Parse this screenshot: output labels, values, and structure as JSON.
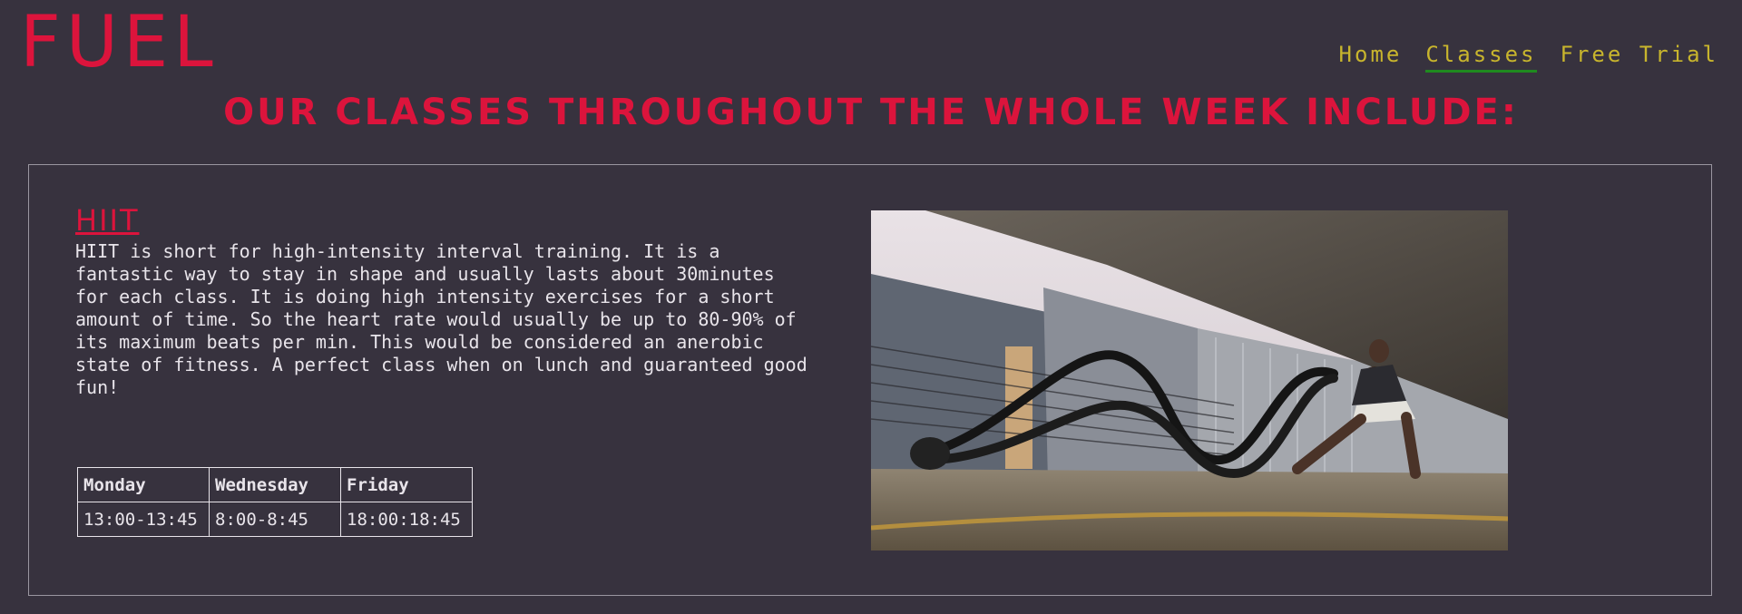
{
  "brand": {
    "logo": "FUEL",
    "accent_color": "#dc143c",
    "nav_color": "#c8b52d",
    "active_underline_color": "#1f8a1f",
    "background": "#37323e"
  },
  "nav": {
    "items": [
      {
        "label": "Home",
        "active": false
      },
      {
        "label": "Classes",
        "active": true
      },
      {
        "label": "Free Trial",
        "active": false
      }
    ]
  },
  "page": {
    "title": "OUR CLASSES THROUGHOUT THE WHOLE WEEK INCLUDE:"
  },
  "hiit": {
    "name": "HIIT",
    "description": "HIIT is short for high-intensity interval training. It is a fantastic way to stay in shape and usually lasts about 30minutes for each class. It is doing high intensity exercises for a short amount of time. So the heart rate would usually be up to 80-90% of its maximum beats per min. This would be considered an anerobic state of fitness. A perfect class when on lunch and guaranteed good fun!",
    "schedule": {
      "days": [
        "Monday",
        "Wednesday",
        "Friday"
      ],
      "times": [
        "13:00-13:45",
        "8:00-8:45",
        "18:00:18:45"
      ]
    },
    "photo_icon": "battle-ropes-photo"
  }
}
